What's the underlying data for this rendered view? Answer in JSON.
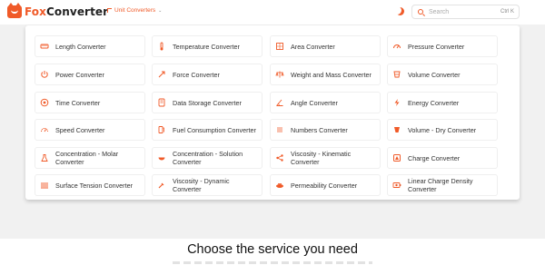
{
  "brand": {
    "fox": "Fox",
    "converter": "Converter",
    "accent": "#f05a28"
  },
  "nav": {
    "menu_label": "Unit Converters",
    "chevron": "⌄"
  },
  "search": {
    "placeholder": "Search",
    "shortcut": "Ctrl K"
  },
  "converters": [
    {
      "label": "Length Converter",
      "icon": "ruler-icon"
    },
    {
      "label": "Temperature Converter",
      "icon": "thermometer-icon"
    },
    {
      "label": "Area Converter",
      "icon": "area-icon"
    },
    {
      "label": "Pressure Converter",
      "icon": "gauge-icon"
    },
    {
      "label": "Power Converter",
      "icon": "power-icon"
    },
    {
      "label": "Force Converter",
      "icon": "force-icon"
    },
    {
      "label": "Weight and Mass Converter",
      "icon": "scale-icon"
    },
    {
      "label": "Volume Converter",
      "icon": "volume-icon"
    },
    {
      "label": "Time Converter",
      "icon": "clock-icon"
    },
    {
      "label": "Data Storage Converter",
      "icon": "storage-icon"
    },
    {
      "label": "Angle Converter",
      "icon": "angle-icon"
    },
    {
      "label": "Energy Converter",
      "icon": "energy-icon"
    },
    {
      "label": "Speed Converter",
      "icon": "speedometer-icon"
    },
    {
      "label": "Fuel Consumption Converter",
      "icon": "fuel-icon"
    },
    {
      "label": "Numbers Converter",
      "icon": "numbers-icon"
    },
    {
      "label": "Volume - Dry Converter",
      "icon": "dry-volume-icon"
    },
    {
      "label": "Concentration - Molar Converter",
      "icon": "flask-icon"
    },
    {
      "label": "Concentration - Solution Converter",
      "icon": "bowl-icon"
    },
    {
      "label": "Viscosity - Kinematic Converter",
      "icon": "share-icon"
    },
    {
      "label": "Charge Converter",
      "icon": "charge-icon"
    },
    {
      "label": "Surface Tension Converter",
      "icon": "surface-icon"
    },
    {
      "label": "Viscosity - Dynamic Converter",
      "icon": "pipette-icon"
    },
    {
      "label": "Permeability Converter",
      "icon": "permeability-icon"
    },
    {
      "label": "Linear Charge Density Converter",
      "icon": "battery-icon"
    }
  ],
  "section": {
    "title": "Choose the service you need"
  }
}
